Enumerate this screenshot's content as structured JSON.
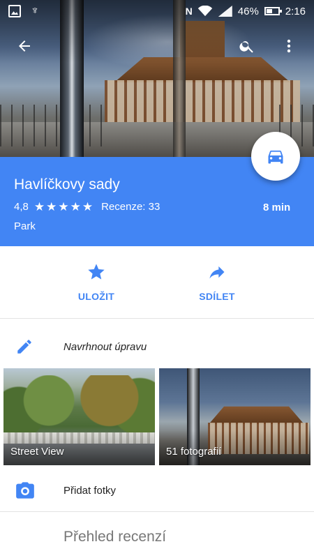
{
  "status_bar": {
    "battery_percent": "46%",
    "battery_level": 0.46,
    "time": "2:16",
    "nfc_label": "N",
    "icons": [
      "gallery-icon",
      "owl-icon",
      "nfc-icon",
      "wifi-icon",
      "signal-icon",
      "battery-icon"
    ]
  },
  "toolbar": {
    "back_icon": "arrow-back-icon",
    "search_icon": "search-icon",
    "more_icon": "more-vert-icon"
  },
  "fab": {
    "icon": "car-icon"
  },
  "place": {
    "title": "Havlíčkovy sady",
    "rating": "4,8",
    "stars": 5,
    "reviews_label": "Recenze: 33",
    "category": "Park",
    "drive_time": "8 min"
  },
  "actions": [
    {
      "label": "ULOŽIT",
      "icon": "star-icon"
    },
    {
      "label": "SDÍLET",
      "icon": "share-icon"
    }
  ],
  "suggest_edit": {
    "label": "Navrhnout úpravu",
    "icon": "pencil-icon"
  },
  "tiles": [
    {
      "caption": "Street View"
    },
    {
      "caption": "51 fotografií"
    }
  ],
  "add_photos": {
    "label": "Přidat fotky",
    "icon": "camera-icon"
  },
  "reviews": {
    "title": "Přehled recenzí"
  },
  "colors": {
    "accent": "#4285f4",
    "white": "#ffffff"
  }
}
